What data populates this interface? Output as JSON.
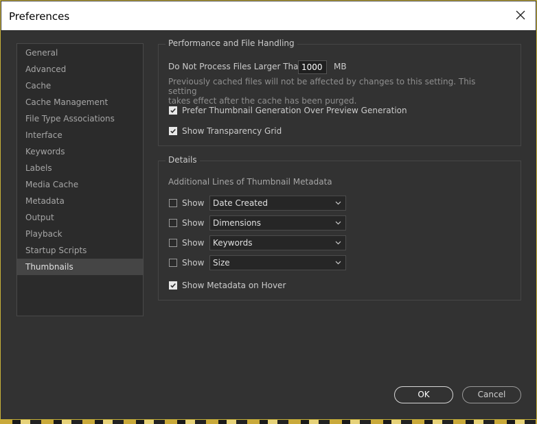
{
  "window": {
    "title": "Preferences"
  },
  "sidebar": {
    "items": [
      {
        "label": "General"
      },
      {
        "label": "Advanced"
      },
      {
        "label": "Cache"
      },
      {
        "label": "Cache Management"
      },
      {
        "label": "File Type Associations"
      },
      {
        "label": "Interface"
      },
      {
        "label": "Keywords"
      },
      {
        "label": "Labels"
      },
      {
        "label": "Media Cache"
      },
      {
        "label": "Metadata"
      },
      {
        "label": "Output"
      },
      {
        "label": "Playback"
      },
      {
        "label": "Startup Scripts"
      },
      {
        "label": "Thumbnails",
        "selected": true
      }
    ]
  },
  "performance": {
    "legend": "Performance and File Handling",
    "max_size_label": "Do Not Process Files Larger Than",
    "max_size_value": "1000",
    "max_size_unit": "MB",
    "hint_line1": "Previously cached files will not be affected by changes to this setting. This setting",
    "hint_line2": "takes effect after the cache has been purged.",
    "prefer_thumbnail_label": "Prefer Thumbnail Generation Over Preview Generation",
    "prefer_thumbnail_checked": true,
    "transparency_grid_label": "Show Transparency Grid",
    "transparency_grid_checked": true
  },
  "details": {
    "legend": "Details",
    "metadata_lines_label": "Additional Lines of Thumbnail Metadata",
    "rows": [
      {
        "show_label": "Show",
        "checked": false,
        "value": "Date Created"
      },
      {
        "show_label": "Show",
        "checked": false,
        "value": "Dimensions"
      },
      {
        "show_label": "Show",
        "checked": false,
        "value": "Keywords"
      },
      {
        "show_label": "Show",
        "checked": false,
        "value": "Size"
      }
    ],
    "hover_label": "Show Metadata on Hover",
    "hover_checked": true
  },
  "buttons": {
    "ok": "OK",
    "cancel": "Cancel"
  },
  "icons": {
    "close": "close-icon",
    "check": "checkmark-icon",
    "dropdown": "chevron-down-icon"
  },
  "colors": {
    "dialog_bg": "#323232",
    "selected_item_bg": "#454545",
    "accent_border": "#c9b23a"
  }
}
